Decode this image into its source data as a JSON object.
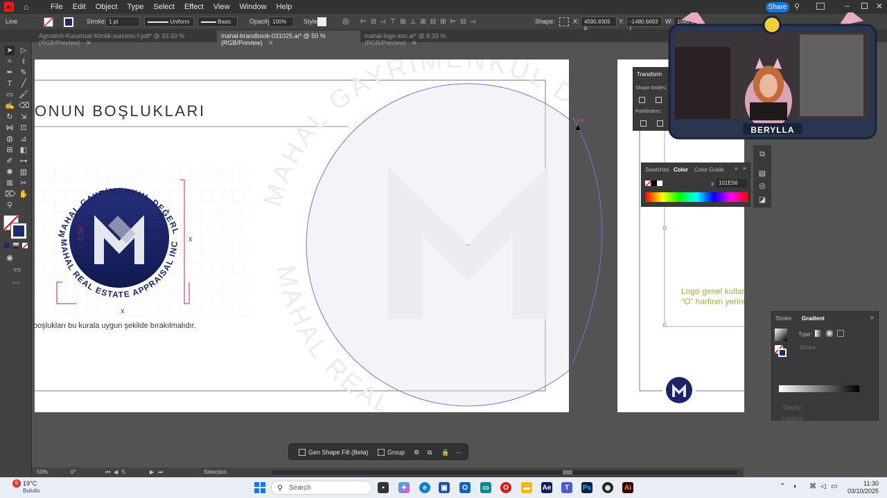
{
  "app": {
    "logo_text": "Ai",
    "menus": [
      "File",
      "Edit",
      "Object",
      "Type",
      "Select",
      "Effect",
      "View",
      "Window",
      "Help"
    ],
    "share_label": "Share"
  },
  "control_bar": {
    "selection_type": "Line",
    "stroke_label": "Stroke:",
    "stroke_weight": "1 pt",
    "profile": "Uniform",
    "brush": "Basic",
    "opacity_label": "Opacity:",
    "opacity_value": "100%",
    "style_label": "Style:",
    "shape_label": "Shape:",
    "x_label": "X:",
    "x_value": "4590.8305 p",
    "y_label": "Y:",
    "y_value": "-1480.6693 j",
    "w_label": "W:",
    "w_value": "1080.5"
  },
  "tabs": [
    {
      "label": "Agrotech-Kurumsal-Kimlik-sunumu-f.pdf* @ 33.33 % (RGB/Preview)",
      "active": false
    },
    {
      "label": "mahal-brandbook-031025.ai* @ 50 % (RGB/Preview)",
      "active": true
    },
    {
      "label": "mahal-logo-son.ai* @ 8.33 % (RGB/Preview)",
      "active": false
    }
  ],
  "artboard": {
    "heading": "ONUN BOŞLUKLARI",
    "caption": "boşlukları bu kurala uygun şekilde bırakılmalıdır.",
    "ring_top": "MAHAL GAYRİMENKUL DEĞERLEME A.Ş.",
    "ring_bottom": "MAHAL REAL ESTATE APPRAISAL INC.",
    "spacing_mark": "0.5x",
    "x_mark": "x",
    "watermark_top": "MAHAL GAYRİMENKUL DE",
    "watermark_left": "MAHAL REAL",
    "anchor_hint": "path"
  },
  "artboard2": {
    "note_line1": "Logo genel kullan",
    "note_line2": "“O” harfinin yerine"
  },
  "panels": {
    "transform": {
      "title": "Transform",
      "shape_modes": "Shape Modes:",
      "pathfinders": "Pathfinders:"
    },
    "color": {
      "tab_swatches": "Swatches",
      "tab_color": "Color",
      "tab_guide": "Color Guide",
      "hex_label": "#",
      "hex_value": "101E56"
    },
    "gradient": {
      "tab_stroke": "Stroke",
      "tab_gradient": "Gradient",
      "type_label": "Type:",
      "stroke_label": "Stroke:",
      "opacity_label": "Opacity:",
      "location_label": "Location:"
    }
  },
  "context_bar": {
    "gen_fill": "Gen Shape Fill (Beta)",
    "group": "Group"
  },
  "status": {
    "zoom": "50%",
    "rotation": "0°",
    "artboard_num": "5",
    "tool": "Selection"
  },
  "webcam": {
    "name_tag": "BERYLLA"
  },
  "taskbar": {
    "weather_temp": "19°C",
    "weather_desc": "Bulutlu",
    "badge": "9",
    "search_placeholder": "Search",
    "time": "11:30",
    "date": "03/10/2025"
  },
  "colors": {
    "accent_blue": "#1473e6",
    "logo_navy": "#101E56",
    "selection_blue": "#5b6fd6",
    "guide_magenta": "#d4145a",
    "note_olive": "#a8a844"
  }
}
